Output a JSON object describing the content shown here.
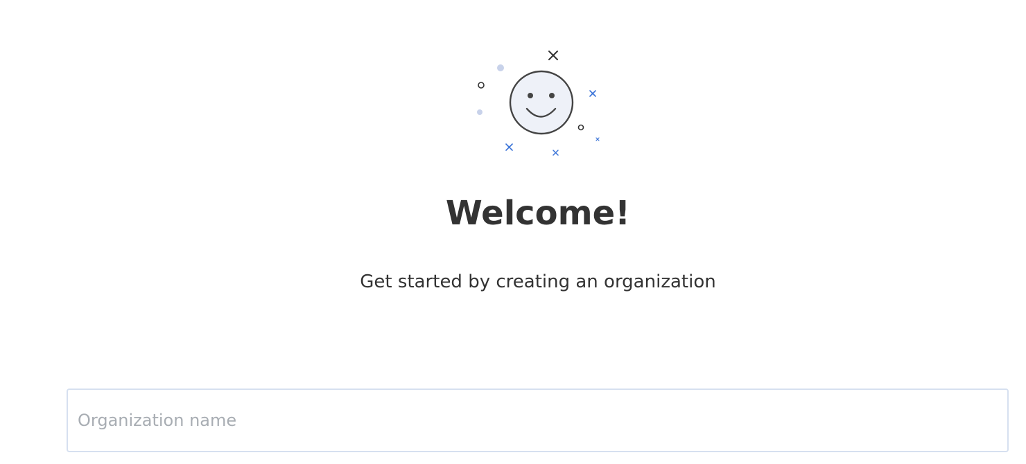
{
  "welcome": {
    "title": "Welcome!",
    "subtitle": "Get started by creating an organization",
    "illustration": "smiley-face-illustration"
  },
  "organization_form": {
    "name_field_value": "",
    "name_field_placeholder": "Organization name"
  },
  "colors": {
    "text": "#333333",
    "accent_blue": "#3b74d8",
    "muted_blue": "#c8d2ea",
    "face_fill": "#eef1f8",
    "input_border": "#d6e0f0",
    "placeholder": "#a8adb3"
  }
}
